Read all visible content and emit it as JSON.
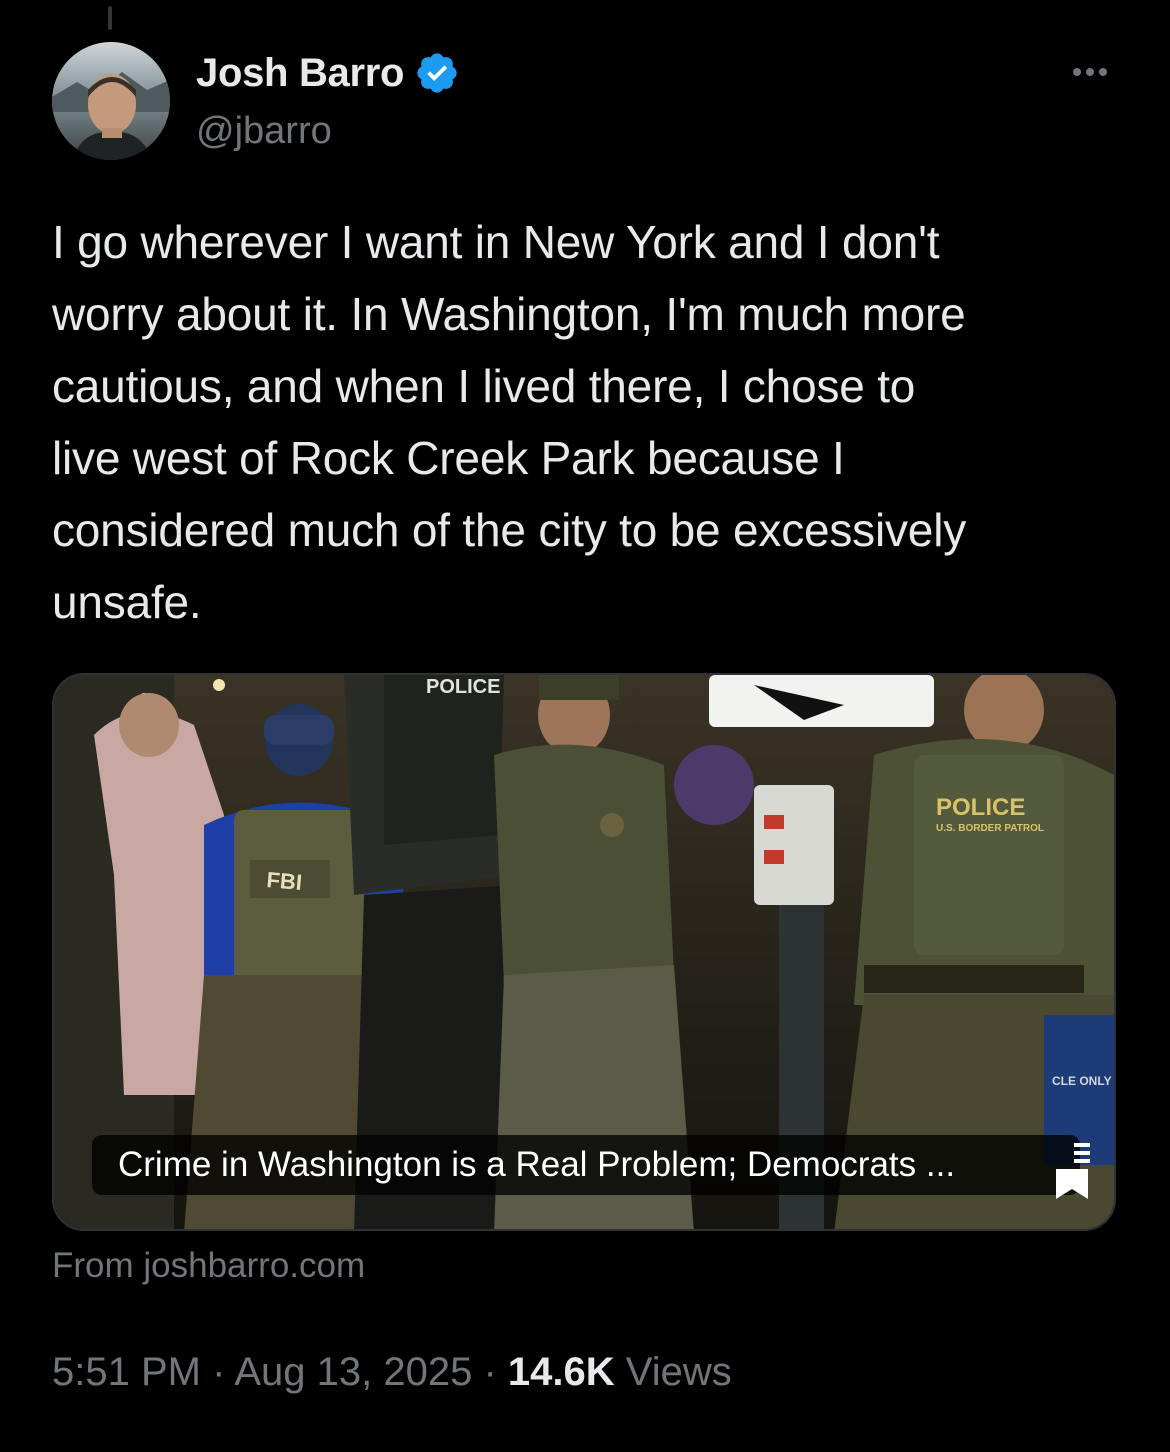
{
  "author": {
    "display_name": "Josh Barro",
    "handle": "@jbarro",
    "verified": true
  },
  "icons": {
    "verified": "verified-badge-icon",
    "more": "more-options-icon",
    "bookmark": "bookmark-icon"
  },
  "colors": {
    "background": "#000000",
    "text_primary": "#e7e9ea",
    "text_secondary": "#71767b",
    "verified_blue": "#1d9bf0",
    "border": "#2f3336"
  },
  "tweet": {
    "text": "I go wherever I want in New York and I don't\nworry about it. In Washington, I'm much more\ncautious, and when I lived there, I chose to\nlive west of Rock Creek Park because I\nconsidered much of the city to be excessively\nunsafe."
  },
  "card": {
    "title": "Crime in Washington is a Real Problem; Democrats ...",
    "source": "From joshbarro.com",
    "image_labels": {
      "fbi": "FBI",
      "police_top": "POLICE",
      "police_patch": "POLICE",
      "patch_subtext": "U.S. BORDER PATROL",
      "recycle": "CLE ONLY"
    }
  },
  "meta": {
    "time": "5:51 PM",
    "separator": "·",
    "date": "Aug 13, 2025",
    "views_count": "14.6K",
    "views_label": "Views"
  }
}
